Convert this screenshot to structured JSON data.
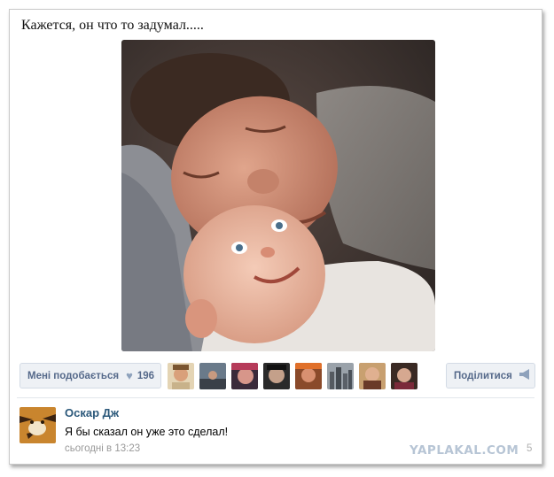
{
  "post": {
    "text": "Кажется, он что то задумал....."
  },
  "actions": {
    "like_label": "Мені подобається",
    "like_icon": "heart-icon",
    "like_count": "196",
    "share_label": "Поділитися",
    "share_icon": "megaphone-icon"
  },
  "likers_count_shown": 8,
  "comment": {
    "author": "Оскар Дж",
    "text": "Я бы сказал он уже это сделал!",
    "time": "сьогодні в 13:23"
  },
  "watermark": {
    "text": "YAPLAKAL.COM",
    "tail": "5"
  },
  "colors": {
    "link": "#2b587a",
    "button_bg": "#eef1f5",
    "button_text": "#55698a",
    "muted": "#999999"
  }
}
